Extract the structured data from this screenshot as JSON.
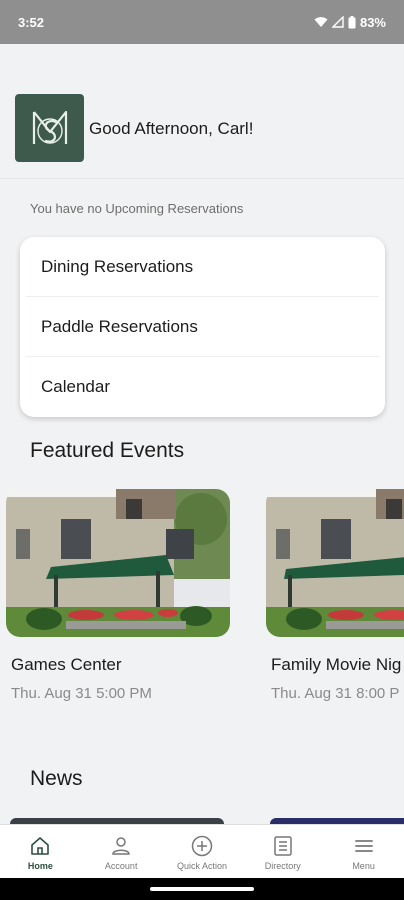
{
  "status_bar": {
    "time": "3:52",
    "battery": "83%",
    "icons": [
      "wifi-icon",
      "signal-icon",
      "battery-icon"
    ]
  },
  "header": {
    "logo": "club-monogram-logo",
    "greeting": "Good Afternoon, Carl!"
  },
  "reservations": {
    "status_text": "You have no Upcoming Reservations",
    "items": [
      {
        "label": "Dining Reservations"
      },
      {
        "label": "Paddle Reservations"
      },
      {
        "label": "Calendar"
      }
    ]
  },
  "featured": {
    "title": "Featured Events",
    "events": [
      {
        "title": "Games Center",
        "date": "Thu. Aug 31 5:00 PM"
      },
      {
        "title": "Family Movie Nig",
        "date": "Thu. Aug 31 8:00 P"
      }
    ]
  },
  "news": {
    "title": "News"
  },
  "bottom_nav": {
    "items": [
      {
        "label": "Home",
        "icon": "home-icon",
        "active": true
      },
      {
        "label": "Account",
        "icon": "person-icon",
        "active": false
      },
      {
        "label": "Quick Action",
        "icon": "plus-circle-icon",
        "active": false
      },
      {
        "label": "Directory",
        "icon": "directory-icon",
        "active": false
      },
      {
        "label": "Menu",
        "icon": "hamburger-icon",
        "active": false
      }
    ]
  },
  "colors": {
    "brand_green": "#3d5a4c",
    "background": "#f1f2f4",
    "status_bar": "#8f8f8f"
  }
}
